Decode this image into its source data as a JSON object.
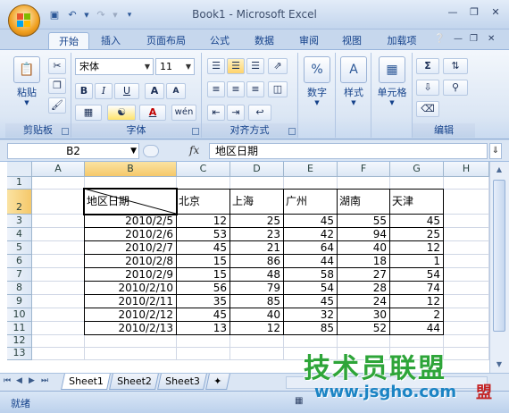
{
  "window": {
    "title": "Book1 - Microsoft Excel"
  },
  "tabs": [
    "开始",
    "插入",
    "页面布局",
    "公式",
    "数据",
    "审阅",
    "视图",
    "加载项"
  ],
  "ribbon": {
    "clipboard": {
      "label": "剪贴板",
      "paste": "粘贴"
    },
    "font": {
      "label": "字体",
      "name": "宋体",
      "size": "11",
      "bold": "B",
      "italic": "I",
      "underline": "U",
      "grow": "A",
      "shrink": "A",
      "font_color": "A",
      "phonetic": "wén",
      "accent": "#c00000"
    },
    "alignment": {
      "label": "对齐方式"
    },
    "number": {
      "label": "数字",
      "percent": "%"
    },
    "styles": {
      "label": "样式"
    },
    "cells": {
      "label": "单元格"
    },
    "editing": {
      "label": "编辑",
      "sum": "Σ"
    }
  },
  "formula_bar": {
    "name_box": "B2",
    "fx": "fx",
    "content": "地区日期"
  },
  "grid": {
    "columns": [
      "A",
      "B",
      "C",
      "D",
      "E",
      "F",
      "G",
      "H"
    ],
    "rows": [
      "1",
      "2",
      "3",
      "4",
      "5",
      "6",
      "7",
      "8",
      "9",
      "10",
      "11",
      "12",
      "13"
    ],
    "header_diag_label": "地区日期",
    "header_cities": [
      "北京",
      "上海",
      "广州",
      "湖南",
      "天津"
    ],
    "data": [
      {
        "date": "2010/2/5",
        "values": [
          "12",
          "25",
          "45",
          "55",
          "45"
        ]
      },
      {
        "date": "2010/2/6",
        "values": [
          "53",
          "23",
          "42",
          "94",
          "25"
        ]
      },
      {
        "date": "2010/2/7",
        "values": [
          "45",
          "21",
          "64",
          "40",
          "12"
        ]
      },
      {
        "date": "2010/2/8",
        "values": [
          "15",
          "86",
          "44",
          "18",
          "1"
        ]
      },
      {
        "date": "2010/2/9",
        "values": [
          "15",
          "48",
          "58",
          "27",
          "54"
        ]
      },
      {
        "date": "2010/2/10",
        "values": [
          "56",
          "79",
          "54",
          "28",
          "74"
        ]
      },
      {
        "date": "2010/2/11",
        "values": [
          "35",
          "85",
          "45",
          "24",
          "12"
        ]
      },
      {
        "date": "2010/2/12",
        "values": [
          "45",
          "40",
          "32",
          "30",
          "2"
        ]
      },
      {
        "date": "2010/2/13",
        "values": [
          "13",
          "12",
          "85",
          "52",
          "44"
        ]
      }
    ]
  },
  "sheets": [
    "Sheet1",
    "Sheet2",
    "Sheet3"
  ],
  "status": {
    "text": "就绪"
  },
  "watermark": {
    "line1": "技术员联盟",
    "line2": "www.jsgho.com",
    "seal": "盟"
  }
}
